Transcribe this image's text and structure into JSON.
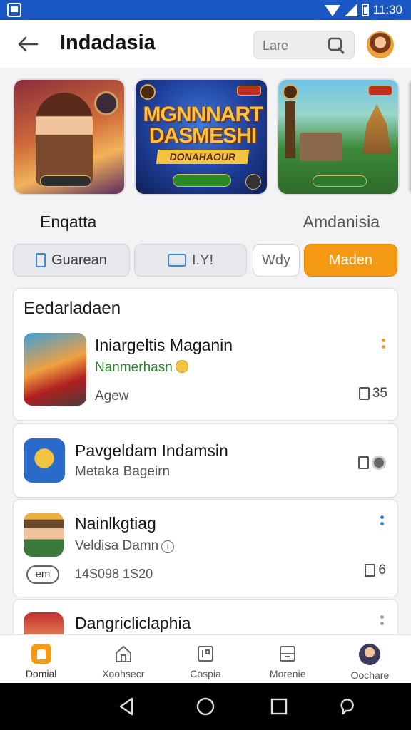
{
  "status_bar": {
    "time": "11:30"
  },
  "app_bar": {
    "title": "Indadasia",
    "search_placeholder": "Lare"
  },
  "banners": [
    {
      "name": "hero-banner",
      "label": ""
    },
    {
      "name": "game-banner",
      "title": "MGNNNART DASMESHI",
      "subtitle": "DONAHAOUR"
    },
    {
      "name": "temple-banner",
      "label": ""
    }
  ],
  "sections": {
    "left": "Enqatta",
    "right": "Amdanisia"
  },
  "filters": [
    {
      "label": "Guarean"
    },
    {
      "label": "I.Y!"
    },
    {
      "label": "Wdy"
    },
    {
      "label": "Maden"
    }
  ],
  "list": {
    "header": "Eedarladaen",
    "items": [
      {
        "title": "Iniargeltis Maganin",
        "subtitle": "Nanmerhasn",
        "meta": "Agew",
        "stat": "35"
      },
      {
        "title": "Pavgeldam Indamsin",
        "subtitle": "Metaka Bageirn",
        "stat": ""
      },
      {
        "title": "Nainlkgtiag",
        "subtitle": "Veldisa Damn",
        "chip": "em",
        "meta": "14S098 1S20",
        "stat": "6"
      },
      {
        "title": "Dangricliclaphia"
      }
    ]
  },
  "bottom_nav": [
    {
      "label": "Domial"
    },
    {
      "label": "Xoohsecr"
    },
    {
      "label": "Cospia"
    },
    {
      "label": "Morenie"
    },
    {
      "label": "Oochare"
    }
  ],
  "colors": {
    "accent": "#f39a12",
    "status_bar": "#1a56c4",
    "link_dot": "#3a8ad8"
  }
}
